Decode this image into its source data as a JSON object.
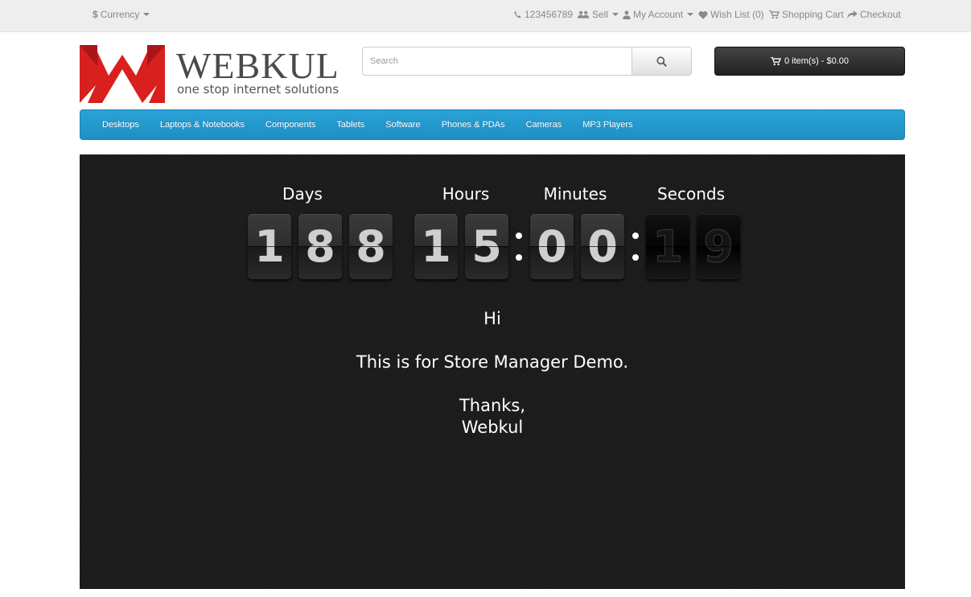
{
  "topbar": {
    "currency_symbol": "$",
    "currency_label": "Currency",
    "phone": "123456789",
    "sell": "Sell",
    "my_account": "My Account",
    "wish_list": "Wish List (0)",
    "shopping_cart": "Shopping Cart",
    "checkout": "Checkout"
  },
  "header": {
    "logo_word": "WEBKUL",
    "logo_tagline": "one stop internet solutions",
    "search_placeholder": "Search",
    "cart_label": "0 item(s) - $0.00"
  },
  "menu": {
    "items": [
      "Desktops",
      "Laptops & Notebooks",
      "Components",
      "Tablets",
      "Software",
      "Phones & PDAs",
      "Cameras",
      "MP3 Players"
    ]
  },
  "countdown": {
    "labels": {
      "days": "Days",
      "hours": "Hours",
      "minutes": "Minutes",
      "seconds": "Seconds"
    },
    "days_digits": [
      "1",
      "8",
      "8"
    ],
    "hours_digits": [
      "1",
      "5"
    ],
    "minutes_digits": [
      "0",
      "0"
    ],
    "seconds_digits": [
      "1",
      "9"
    ]
  },
  "message": {
    "line1": "Hi",
    "line2": "This is for Store Manager Demo.",
    "line3": "Thanks,",
    "line4": "Webkul"
  },
  "colors": {
    "menu_bg": "#229ad0",
    "logo_red": "#d8201f",
    "panel_bg": "#1d1d1d"
  }
}
